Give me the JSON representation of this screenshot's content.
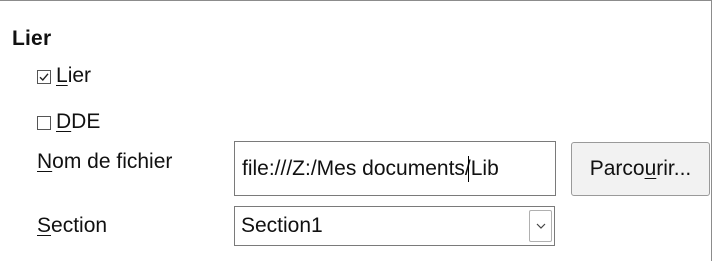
{
  "group": {
    "title": "Lier"
  },
  "link_checkbox": {
    "label_mnemonic": "L",
    "label_rest": "ier",
    "checked": true
  },
  "dde_checkbox": {
    "label_mnemonic": "D",
    "label_rest": "DE",
    "checked": false
  },
  "filename": {
    "label_mnemonic": "N",
    "label_rest": "om de fichier",
    "value": "file:///Z:/Mes documents/Lib"
  },
  "browse_button": {
    "label_pre": "Parco",
    "label_mnemonic": "u",
    "label_post": "rir..."
  },
  "section": {
    "label_mnemonic": "S",
    "label_rest": "ection",
    "selected": "Section1"
  }
}
